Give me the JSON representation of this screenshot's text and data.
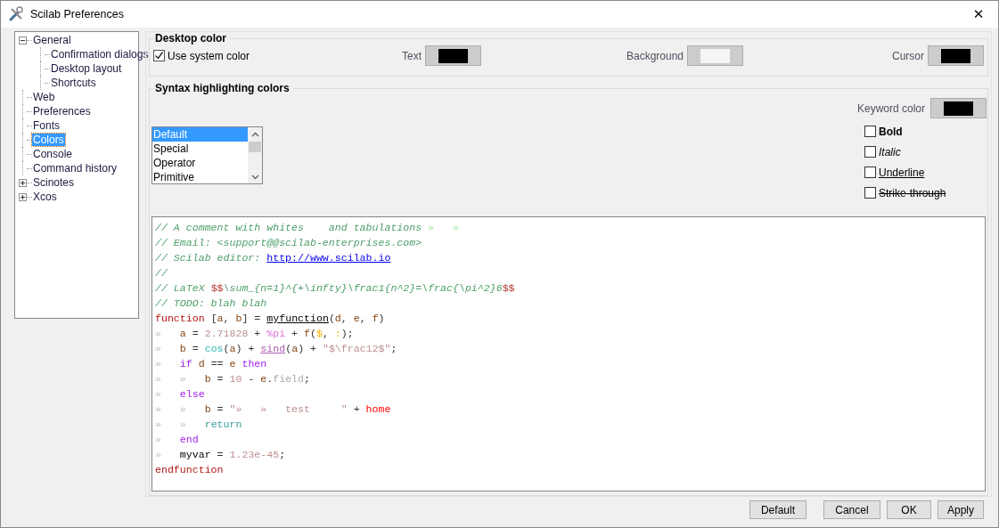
{
  "window": {
    "title": "Scilab Preferences",
    "close": "✕"
  },
  "tree": [
    {
      "label": "General",
      "expanded": true,
      "selected": false,
      "children": [
        {
          "label": "Confirmation dialogs",
          "selected": false
        },
        {
          "label": "Desktop layout",
          "selected": false
        },
        {
          "label": "Shortcuts",
          "selected": false
        }
      ]
    },
    {
      "label": "Web",
      "selected": false
    },
    {
      "label": "Preferences",
      "selected": false
    },
    {
      "label": "Fonts",
      "selected": false
    },
    {
      "label": "Colors",
      "selected": true
    },
    {
      "label": "Console",
      "selected": false
    },
    {
      "label": "Command history",
      "selected": false
    },
    {
      "label": "Scinotes",
      "expanded": false,
      "selected": false
    },
    {
      "label": "Xcos",
      "expanded": false,
      "selected": false
    }
  ],
  "desktop_color": {
    "title": "Desktop color",
    "use_system": {
      "label": "Use system color",
      "checked": true
    },
    "colors": [
      {
        "label": "Text",
        "color": "#000000"
      },
      {
        "label": "Background",
        "color": "#f5f5f5"
      },
      {
        "label": "Cursor",
        "color": "#000000"
      }
    ]
  },
  "syntax": {
    "title": "Syntax highlighting colors",
    "categories": [
      {
        "label": "Default",
        "selected": true
      },
      {
        "label": "Special",
        "selected": false
      },
      {
        "label": "Operator",
        "selected": false
      },
      {
        "label": "Primitive",
        "selected": false
      }
    ],
    "keyword_color": {
      "label": "Keyword color",
      "color": "#000000"
    },
    "styles": [
      {
        "label": "Bold",
        "kind": "bold",
        "checked": false
      },
      {
        "label": "Italic",
        "kind": "italic",
        "checked": false
      },
      {
        "label": "Underline",
        "kind": "underline",
        "checked": false
      },
      {
        "label": "Strike-through",
        "kind": "strike",
        "checked": false
      }
    ],
    "preview": [
      [
        {
          "kind": "comment",
          "text": "// A comment with whites    and tabulations "
        },
        {
          "kind": "ctab",
          "text": "»   »"
        }
      ],
      [
        {
          "kind": "comment",
          "text": "// Email: <support@@scilab-enterprises.com>"
        }
      ],
      [
        {
          "kind": "comment",
          "text": "// Scilab editor: "
        },
        {
          "kind": "url",
          "text": "http://www.scilab.io"
        }
      ],
      [
        {
          "kind": "comment",
          "text": "//"
        }
      ],
      [
        {
          "kind": "comment",
          "text": "// LaTeX "
        },
        {
          "kind": "latex",
          "text": "$$"
        },
        {
          "kind": "comment",
          "text": "\\sum_{n=1}^{+\\infty}\\frac1{n^2}=\\frac{\\pi^2}6"
        },
        {
          "kind": "latex",
          "text": "$$"
        }
      ],
      [
        {
          "kind": "comment",
          "text": "// TODO: blah blah"
        }
      ],
      [
        {
          "kind": "keyword",
          "text": "function"
        },
        {
          "kind": "op",
          "text": " ["
        },
        {
          "kind": "var",
          "text": "a"
        },
        {
          "kind": "op",
          "text": ", "
        },
        {
          "kind": "var",
          "text": "b"
        },
        {
          "kind": "op",
          "text": "] = "
        },
        {
          "kind": "funcname",
          "text": "myfunction"
        },
        {
          "kind": "op",
          "text": "("
        },
        {
          "kind": "var",
          "text": "d"
        },
        {
          "kind": "op",
          "text": ", "
        },
        {
          "kind": "var",
          "text": "e"
        },
        {
          "kind": "op",
          "text": ", "
        },
        {
          "kind": "var",
          "text": "f"
        },
        {
          "kind": "op",
          "text": ")"
        }
      ],
      [
        {
          "kind": "tab",
          "text": "»   "
        },
        {
          "kind": "var",
          "text": "a"
        },
        {
          "kind": "op",
          "text": " = "
        },
        {
          "kind": "num",
          "text": "2.71828"
        },
        {
          "kind": "op",
          "text": " + "
        },
        {
          "kind": "const",
          "text": "%pi"
        },
        {
          "kind": "op",
          "text": " + "
        },
        {
          "kind": "var",
          "text": "f"
        },
        {
          "kind": "op",
          "text": "("
        },
        {
          "kind": "special",
          "text": "$"
        },
        {
          "kind": "op",
          "text": ", "
        },
        {
          "kind": "special",
          "text": ":"
        },
        {
          "kind": "op",
          "text": ");"
        }
      ],
      [
        {
          "kind": "tab",
          "text": "»   "
        },
        {
          "kind": "var",
          "text": "b"
        },
        {
          "kind": "op",
          "text": " = "
        },
        {
          "kind": "command",
          "text": "cos"
        },
        {
          "kind": "op",
          "text": "("
        },
        {
          "kind": "var",
          "text": "a"
        },
        {
          "kind": "op",
          "text": ") + "
        },
        {
          "kind": "macro",
          "text": "sind"
        },
        {
          "kind": "op",
          "text": "("
        },
        {
          "kind": "var",
          "text": "a"
        },
        {
          "kind": "op",
          "text": ") + "
        },
        {
          "kind": "string",
          "text": "\"$\\frac12$\""
        },
        {
          "kind": "op",
          "text": ";"
        }
      ],
      [
        {
          "kind": "tab",
          "text": "»   "
        },
        {
          "kind": "control",
          "text": "if"
        },
        {
          "kind": "var",
          "text": " d"
        },
        {
          "kind": "op",
          "text": " == "
        },
        {
          "kind": "var",
          "text": "e "
        },
        {
          "kind": "control",
          "text": "then"
        }
      ],
      [
        {
          "kind": "tab",
          "text": "»   »   "
        },
        {
          "kind": "var",
          "text": "b"
        },
        {
          "kind": "op",
          "text": " = "
        },
        {
          "kind": "num",
          "text": "10"
        },
        {
          "kind": "op",
          "text": " - "
        },
        {
          "kind": "var",
          "text": "e"
        },
        {
          "kind": "op",
          "text": "."
        },
        {
          "kind": "field",
          "text": "field"
        },
        {
          "kind": "op",
          "text": ";"
        }
      ],
      [
        {
          "kind": "tab",
          "text": "»   "
        },
        {
          "kind": "control",
          "text": "else"
        }
      ],
      [
        {
          "kind": "tab",
          "text": "»   »   "
        },
        {
          "kind": "var",
          "text": "b"
        },
        {
          "kind": "op",
          "text": " = "
        },
        {
          "kind": "string",
          "text": "\"»   »   test     \""
        },
        {
          "kind": "op",
          "text": " + "
        },
        {
          "kind": "local",
          "text": "home"
        }
      ],
      [
        {
          "kind": "tab",
          "text": "»   »   "
        },
        {
          "kind": "skip",
          "text": "return"
        }
      ],
      [
        {
          "kind": "tab",
          "text": "»   "
        },
        {
          "kind": "control",
          "text": "end"
        }
      ],
      [
        {
          "kind": "tab",
          "text": "»   "
        },
        {
          "kind": "plain",
          "text": "myvar"
        },
        {
          "kind": "op",
          "text": " = "
        },
        {
          "kind": "num",
          "text": "1.23e-45"
        },
        {
          "kind": "op",
          "text": ";"
        }
      ],
      [
        {
          "kind": "keyword",
          "text": "endfunction"
        }
      ]
    ]
  },
  "buttons": [
    "Default",
    "Cancel",
    "OK",
    "Apply"
  ]
}
